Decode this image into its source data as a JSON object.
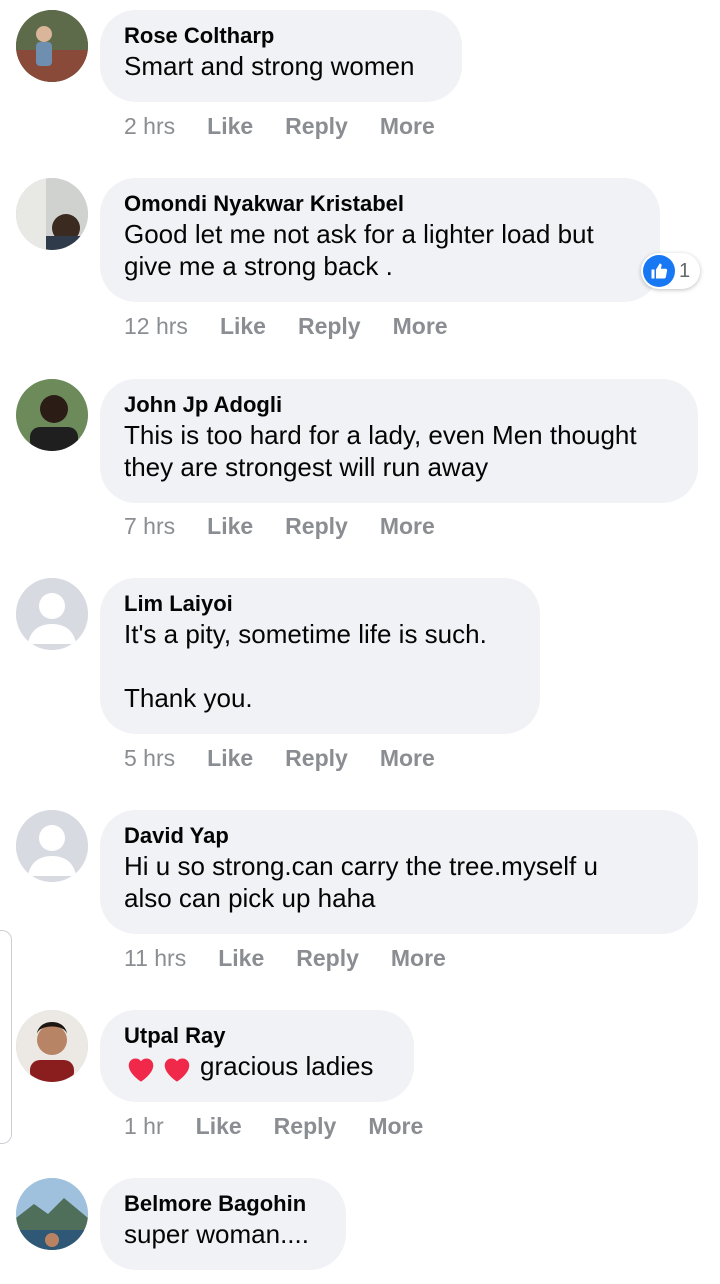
{
  "comments": [
    {
      "name": "Rose Coltharp",
      "text": "Smart and strong women",
      "time": "2 hrs",
      "like": "Like",
      "reply": "Reply",
      "more": "More"
    },
    {
      "name": "Omondi Nyakwar Kristabel",
      "text": "Good let me not ask for a lighter load but\ngive me a strong back .",
      "time": "12 hrs",
      "like": "Like",
      "reply": "Reply",
      "more": "More",
      "reactions": "1"
    },
    {
      "name": "John Jp Adogli",
      "text": "This is too hard for a lady, even Men thought\nthey are strongest will run away",
      "time": "7 hrs",
      "like": "Like",
      "reply": "Reply",
      "more": "More"
    },
    {
      "name": "Lim Laiyoi",
      "text": "It's a pity, sometime life is such.\n\nThank you.",
      "time": "5 hrs",
      "like": "Like",
      "reply": "Reply",
      "more": "More"
    },
    {
      "name": "David Yap",
      "text": "Hi u so strong.can carry the tree.myself u\nalso can pick up haha",
      "time": "11 hrs",
      "like": "Like",
      "reply": "Reply",
      "more": "More"
    },
    {
      "name": "Utpal Ray",
      "text": "gracious ladies",
      "time": "1 hr",
      "like": "Like",
      "reply": "Reply",
      "more": "More"
    },
    {
      "name": "Belmore Bagohin",
      "text": "super woman...."
    }
  ],
  "colors": {
    "bubble": "#f0f2f5",
    "meta": "#8a8d91",
    "like_blue": "#1877f2",
    "heart": "#f02849"
  }
}
